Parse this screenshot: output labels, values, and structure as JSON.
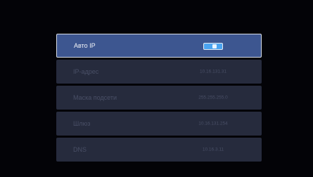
{
  "colors": {
    "background": "#030307",
    "row": "#262b3d",
    "selected_row": "#3d5690",
    "selected_border": "#d7dce6",
    "toggle_on": "#4aa3f0",
    "muted_text": "#494f66"
  },
  "network_settings": {
    "auto_ip": {
      "label": "Авто IP",
      "toggle_state": "on"
    },
    "items": [
      {
        "label": "IP-адрес",
        "value": "10.16.131.31"
      },
      {
        "label": "Маска подсети",
        "value": "255.255.255.0"
      },
      {
        "label": "Шлюз",
        "value": "10.16.131.254"
      },
      {
        "label": "DNS",
        "value": "10.16.3.11"
      }
    ]
  }
}
